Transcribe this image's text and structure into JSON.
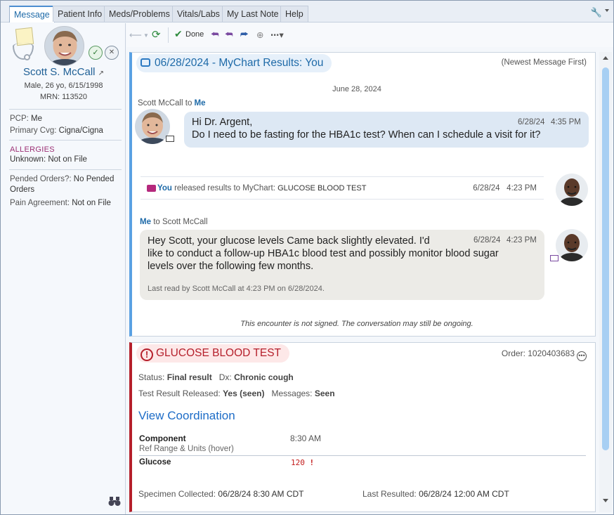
{
  "tabs": [
    "Message",
    "Patient Info",
    "Meds/Problems",
    "Vitals/Labs",
    "My Last Note",
    "Help"
  ],
  "sidebar": {
    "name": "Scott S. McCall",
    "demographics": "Male, 26 yo, 6/15/1998",
    "mrn": "MRN: 113520",
    "pcp_label": "PCP:",
    "pcp_value": "Me",
    "cvg_label": "Primary Cvg:",
    "cvg_value": "Cigna/Cigna",
    "allergies_header": "ALLERGIES",
    "allergy_label": "Unknown:",
    "allergy_value": "Not on File",
    "pended_label": "Pended Orders?:",
    "pended_value": "No Pended Orders",
    "pain_label": "Pain Agreement:",
    "pain_value": "Not on File"
  },
  "toolbar": {
    "done_label": "Done"
  },
  "message": {
    "title": "06/28/2024 - MyChart Results: You",
    "order_note": "(Newest Message First)",
    "date_header": "June 28, 2024",
    "msg1": {
      "from": "Scott McCall",
      "to_word": "to",
      "to": "Me",
      "greeting": "Hi Dr. Argent,",
      "body": "Do I need to be fasting for the HBA1c test? When can I schedule a visit for it?",
      "date": "6/28/24",
      "time": "4:35 PM"
    },
    "release": {
      "actor": "You",
      "text": "released results to MyChart:",
      "test": "GLUCOSE BLOOD TEST",
      "date": "6/28/24",
      "time": "4:23 PM"
    },
    "msg2": {
      "from": "Me",
      "to_text": "to Scott McCall",
      "line1": "Hey Scott, your glucose levels Came back slightly elevated. I'd",
      "line2": "like to conduct a follow-up HBA1c blood test and possibly monitor blood sugar",
      "line3": "levels over the following few months.",
      "date": "6/28/24",
      "time": "4:23 PM",
      "last_read": "Last read by Scott McCall at  4:23 PM on 6/28/2024."
    },
    "unsigned_note": "This encounter is not signed. The conversation may still be ongoing."
  },
  "result": {
    "title": "GLUCOSE BLOOD TEST",
    "order": "Order: 1020403683",
    "status_label": "Status:",
    "status_value": "Final result",
    "dx_label": "Dx:",
    "dx_value": "Chronic cough",
    "released_label": "Test Result Released:",
    "released_value": "Yes (seen)",
    "messages_label": "Messages:",
    "messages_value": "Seen",
    "view_link": "View Coordination",
    "component_hdr": "Component",
    "time_hdr": "8:30 AM",
    "ref_range": "Ref Range & Units (hover)",
    "glucose_label": "Glucose",
    "glucose_value": "120",
    "glucose_flag": "!",
    "specimen_label": "Specimen Collected:",
    "specimen_value": "06/28/24  8:30 AM CDT",
    "last_resulted_label": "Last Resulted:",
    "last_resulted_value": "06/28/24 12:00 AM CDT"
  },
  "icons": [
    "sticky-note-icon",
    "stethoscope-icon",
    "mychart-check-icon",
    "mychart-x-icon",
    "binoculars-icon",
    "wrench-icon",
    "back-icon",
    "refresh-icon",
    "checkmark-icon",
    "reply-icon",
    "reply-all-icon",
    "forward-icon",
    "zoom-icon",
    "more-icon",
    "message-icon",
    "mail-icon",
    "alert-circle-icon"
  ],
  "colors": {
    "accent": "#1e6aa8",
    "alert": "#b51f2b",
    "message_bar": "#5aa1e3"
  }
}
